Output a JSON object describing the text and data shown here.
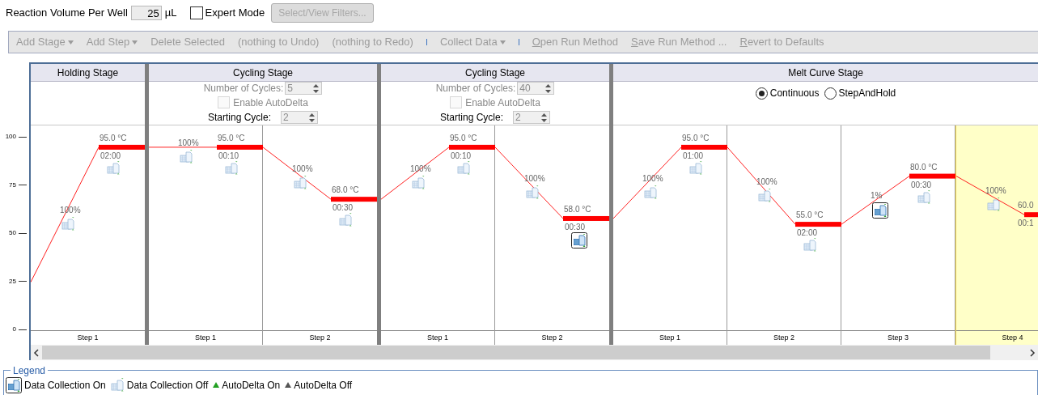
{
  "reaction_volume": {
    "label": "Reaction Volume Per Well",
    "value": "25",
    "unit": "µL"
  },
  "expert_mode": {
    "label": "Expert Mode",
    "checked": false
  },
  "filters_button": {
    "label": "Select/View Filters...",
    "disabled": true
  },
  "toolbar": [
    {
      "kind": "menu",
      "label": "Add Stage",
      "disabled": true
    },
    {
      "kind": "menu",
      "label": "Add Step",
      "disabled": true
    },
    {
      "kind": "action",
      "label": "Delete Selected",
      "disabled": true
    },
    {
      "kind": "action",
      "label": "(nothing to Undo)",
      "disabled": true
    },
    {
      "kind": "action",
      "label": "(nothing to Redo)",
      "disabled": true
    },
    {
      "kind": "separator"
    },
    {
      "kind": "menu",
      "label": "Collect Data",
      "disabled": true
    },
    {
      "kind": "separator"
    },
    {
      "kind": "action",
      "label": "Open Run Method",
      "disabled": true,
      "mnemonic_underlined": true
    },
    {
      "kind": "action",
      "label": "Save Run Method ...",
      "disabled": true,
      "mnemonic_underlined": true
    },
    {
      "kind": "action",
      "label": "Revert to Defaults",
      "disabled": true,
      "mnemonic_underlined": true
    }
  ],
  "y_axis": {
    "ticks": [
      "100",
      "75",
      "50",
      "25",
      "0"
    ]
  },
  "stages": [
    {
      "kind": "hold",
      "title": "Holding Stage",
      "steps": [
        {
          "label": "Step 1",
          "selected": false,
          "ramp": {
            "rate": "100%",
            "collect": false
          },
          "hold": {
            "temp": "95.0 °C",
            "time": "02:00",
            "collect": false
          }
        }
      ]
    },
    {
      "kind": "cycling",
      "title": "Cycling Stage",
      "cycles": {
        "label": "Number of Cycles:",
        "value": "5",
        "disabled": true
      },
      "auto_delta": {
        "label": "Enable AutoDelta",
        "checked": false,
        "disabled": true
      },
      "starting_cycle": {
        "label": "Starting Cycle:",
        "value": "2",
        "disabled": true
      },
      "steps": [
        {
          "label": "Step 1",
          "selected": false,
          "ramp": {
            "rate": "100%",
            "collect": false
          },
          "hold": {
            "temp": "95.0 °C",
            "time": "00:10",
            "collect": false
          }
        },
        {
          "label": "Step 2",
          "selected": false,
          "ramp": {
            "rate": "100%",
            "collect": false
          },
          "hold": {
            "temp": "68.0 °C",
            "time": "00:30",
            "collect": false
          }
        }
      ]
    },
    {
      "kind": "cycling",
      "title": "Cycling Stage",
      "cycles": {
        "label": "Number of Cycles:",
        "value": "40",
        "disabled": true
      },
      "auto_delta": {
        "label": "Enable AutoDelta",
        "checked": false,
        "disabled": true
      },
      "starting_cycle": {
        "label": "Starting Cycle:",
        "value": "2",
        "disabled": true
      },
      "steps": [
        {
          "label": "Step 1",
          "selected": false,
          "ramp": {
            "rate": "100%",
            "collect": false
          },
          "hold": {
            "temp": "95.0 °C",
            "time": "00:10",
            "collect": false
          }
        },
        {
          "label": "Step 2",
          "selected": false,
          "ramp": {
            "rate": "100%",
            "collect": false
          },
          "hold": {
            "temp": "58.0 °C",
            "time": "00:30",
            "collect": true
          }
        }
      ]
    },
    {
      "kind": "melt",
      "title": "Melt Curve Stage",
      "modes": [
        {
          "label": "Continuous",
          "selected": true
        },
        {
          "label": "StepAndHold",
          "selected": false
        }
      ],
      "steps": [
        {
          "label": "Step 1",
          "selected": false,
          "ramp": {
            "rate": "100%",
            "collect": false
          },
          "hold": {
            "temp": "95.0 °C",
            "time": "01:00",
            "collect": false
          }
        },
        {
          "label": "Step 2",
          "selected": false,
          "ramp": {
            "rate": "100%",
            "collect": false
          },
          "hold": {
            "temp": "55.0 °C",
            "time": "02:00",
            "collect": false
          }
        },
        {
          "label": "Step 3",
          "selected": false,
          "ramp": {
            "rate": "1%",
            "collect": true
          },
          "hold": {
            "temp": "80.0 °C",
            "time": "00:30",
            "collect": false
          }
        },
        {
          "label": "Step 4",
          "selected": true,
          "ramp": {
            "rate": "100%",
            "collect": false
          },
          "hold": {
            "temp": "60.0",
            "time": "00:1"
          }
        }
      ]
    }
  ],
  "legend": {
    "title": "Legend",
    "items": [
      {
        "kind": "collect_on",
        "label": "Data Collection On"
      },
      {
        "kind": "collect_off",
        "label": "Data Collection Off"
      },
      {
        "kind": "autodelta_on",
        "label": "AutoDelta On"
      },
      {
        "kind": "autodelta_off",
        "label": "AutoDelta Off"
      }
    ]
  }
}
